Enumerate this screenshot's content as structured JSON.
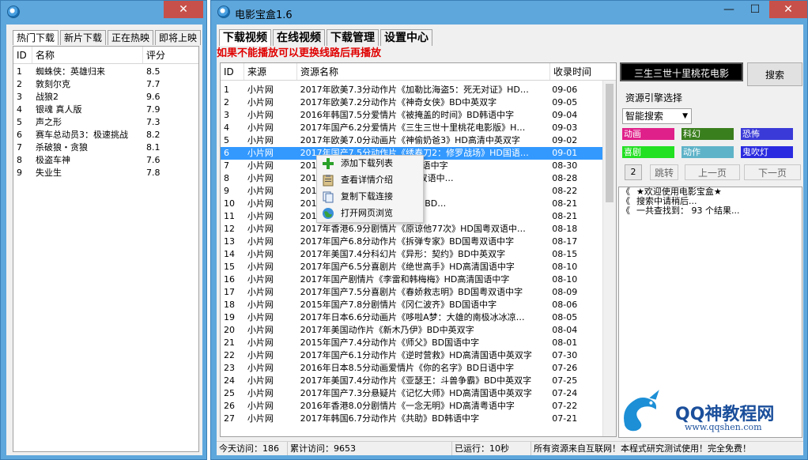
{
  "left_window": {
    "tabs": [
      "热门下载",
      "新片下载",
      "正在热映",
      "即将上映"
    ],
    "active_tab": 0,
    "columns": [
      "ID",
      "名称",
      "评分"
    ],
    "rows": [
      {
        "id": "1",
        "name": "蜘蛛侠：英雄归来",
        "score": "8.5"
      },
      {
        "id": "2",
        "name": "敦刻尔克",
        "score": "7.7"
      },
      {
        "id": "3",
        "name": "战狼2",
        "score": "9.6"
      },
      {
        "id": "4",
        "name": "银魂 真人版",
        "score": "7.9"
      },
      {
        "id": "5",
        "name": "声之形",
        "score": "7.3"
      },
      {
        "id": "6",
        "name": "赛车总动员3：极速挑战",
        "score": "8.2"
      },
      {
        "id": "7",
        "name": "杀破狼・贪狼",
        "score": "8.1"
      },
      {
        "id": "8",
        "name": "极盗车神",
        "score": "7.6"
      },
      {
        "id": "9",
        "name": "失业生",
        "score": "7.8"
      }
    ],
    "close_symbol": "✕"
  },
  "main_window": {
    "title": "电影宝盒1.6",
    "min_symbol": "—",
    "max_symbol": "☐",
    "close_symbol": "✕",
    "tabs": [
      "下载视频",
      "在线视频",
      "下载管理",
      "设置中心"
    ],
    "notice": "如果不能播放可以更换线路后再播放",
    "columns": [
      "ID",
      "来源",
      "资源名称",
      "收录时间"
    ],
    "selected_row": 5,
    "rows": [
      {
        "id": "1",
        "src": "小片网",
        "name": "2017年欧美7.3分动作片《加勒比海盗5：死无对证》HD…",
        "date": "09-06"
      },
      {
        "id": "2",
        "src": "小片网",
        "name": "2017年欧美7.2分动作片《神奇女侠》BD中英双字",
        "date": "09-05"
      },
      {
        "id": "3",
        "src": "小片网",
        "name": "2016年韩国7.5分爱情片《被掩盖的时间》BD韩语中字",
        "date": "09-04"
      },
      {
        "id": "4",
        "src": "小片网",
        "name": "2017年国产6.2分爱情片《三生三世十里桃花电影版》H…",
        "date": "09-03"
      },
      {
        "id": "5",
        "src": "小片网",
        "name": "2017年欧美7.0分动画片《神偷奶爸3》HD高清中英双字",
        "date": "09-02"
      },
      {
        "id": "6",
        "src": "小片网",
        "name": "2017年国产7.5分动作片《绣春刀2：修罗战场》HD国语…",
        "date": "09-01"
      },
      {
        "id": "7",
        "src": "小片网",
        "name": "2017…《…诞生在中国》BD国语中字",
        "date": "08-30"
      },
      {
        "id": "8",
        "src": "小片网",
        "name": "2017…《…护卫队2》BD国英双语中…",
        "date": "08-28"
      },
      {
        "id": "9",
        "src": "小片网",
        "name": "2017…HD高清国语中英双字",
        "date": "08-22"
      },
      {
        "id": "10",
        "src": "小片网",
        "name": "2017…《…巴利王(下)：终结》BD…",
        "date": "08-21"
      },
      {
        "id": "11",
        "src": "小片网",
        "name": "2017…2》HD高清粤双语中字",
        "date": "08-21"
      },
      {
        "id": "12",
        "src": "小片网",
        "name": "2017年香港6.9分剧情片《原谅他77次》HD国粤双语中…",
        "date": "08-18"
      },
      {
        "id": "13",
        "src": "小片网",
        "name": "2017年国产6.8分动作片《拆弹专家》BD国粤双语中字",
        "date": "08-17"
      },
      {
        "id": "14",
        "src": "小片网",
        "name": "2017年美国7.4分科幻片《异形：契约》BD中英双字",
        "date": "08-15"
      },
      {
        "id": "15",
        "src": "小片网",
        "name": "2017年国产6.5分喜剧片《绝世高手》HD高清国语中字",
        "date": "08-10"
      },
      {
        "id": "16",
        "src": "小片网",
        "name": "2017年国产剧情片《李雷和韩梅梅》HD高清国语中字",
        "date": "08-10"
      },
      {
        "id": "17",
        "src": "小片网",
        "name": "2017年国产7.5分喜剧片《春娇救志明》BD国粤双语中字",
        "date": "08-09"
      },
      {
        "id": "18",
        "src": "小片网",
        "name": "2015年国产7.8分剧情片《冈仁波齐》BD国语中字",
        "date": "08-06"
      },
      {
        "id": "19",
        "src": "小片网",
        "name": "2017年日本6.6分动画片《哆啦A梦：大雄的南极冰冰凉…",
        "date": "08-05"
      },
      {
        "id": "20",
        "src": "小片网",
        "name": "2017年美国动作片《新木乃伊》BD中英双字",
        "date": "08-04"
      },
      {
        "id": "21",
        "src": "小片网",
        "name": "2015年国产7.4分动作片《师父》BD国语中字",
        "date": "08-01"
      },
      {
        "id": "22",
        "src": "小片网",
        "name": "2017年国产6.1分动作片《逆时营救》HD高清国语中英双字",
        "date": "07-30"
      },
      {
        "id": "23",
        "src": "小片网",
        "name": "2016年日本8.5分动画爱情片《你的名字》BD日语中字",
        "date": "07-26"
      },
      {
        "id": "24",
        "src": "小片网",
        "name": "2017年美国7.4分动作片《亚瑟王：斗兽争霸》BD中英双字",
        "date": "07-25"
      },
      {
        "id": "25",
        "src": "小片网",
        "name": "2017年国产7.3分悬疑片《记忆大师》HD高清国语中英双字",
        "date": "07-24"
      },
      {
        "id": "26",
        "src": "小片网",
        "name": "2016年香港8.0分剧情片《一念无明》HD高清粤语中字",
        "date": "07-22"
      },
      {
        "id": "27",
        "src": "小片网",
        "name": "2017年韩国6.7分动作片《共助》BD韩语中字",
        "date": "07-21"
      }
    ],
    "context_menu": [
      "添加下载列表",
      "查看详情介绍",
      "复制下载连接",
      "打开网页浏览"
    ],
    "search_box_value": "三生三世十里桃花电影",
    "search_button": "搜索",
    "engine_label": "资源引擎选择",
    "engine_select": "智能搜索",
    "categories": [
      {
        "label": "动画",
        "color": "#e0208a"
      },
      {
        "label": "科幻",
        "color": "#3a7f1e"
      },
      {
        "label": "恐怖",
        "color": "#3a3ad8"
      },
      {
        "label": "喜剧",
        "color": "#22e022"
      },
      {
        "label": "动作",
        "color": "#5fb3c8"
      },
      {
        "label": "鬼吹灯",
        "color": "#2a2ae0"
      }
    ],
    "page_number": "2",
    "jump_button": "跳转",
    "prev_button": "上一页",
    "next_button": "下一页",
    "log_lines": [
      {
        "mark": "《",
        "text": "★欢迎使用电影宝盒★"
      },
      {
        "mark": "《",
        "text": "搜索中请稍后..."
      },
      {
        "mark": "《",
        "text": "一共查找到：  93 个结果..."
      }
    ],
    "status": {
      "today": "今天访问：186",
      "total": "累计访问：9653",
      "running": "已运行：10秒",
      "notice": "所有资源来自互联网！本程式研究测试使用！完全免费！"
    }
  },
  "watermark": {
    "name": "QQ神教程网",
    "url": "www.qqshen.com"
  }
}
